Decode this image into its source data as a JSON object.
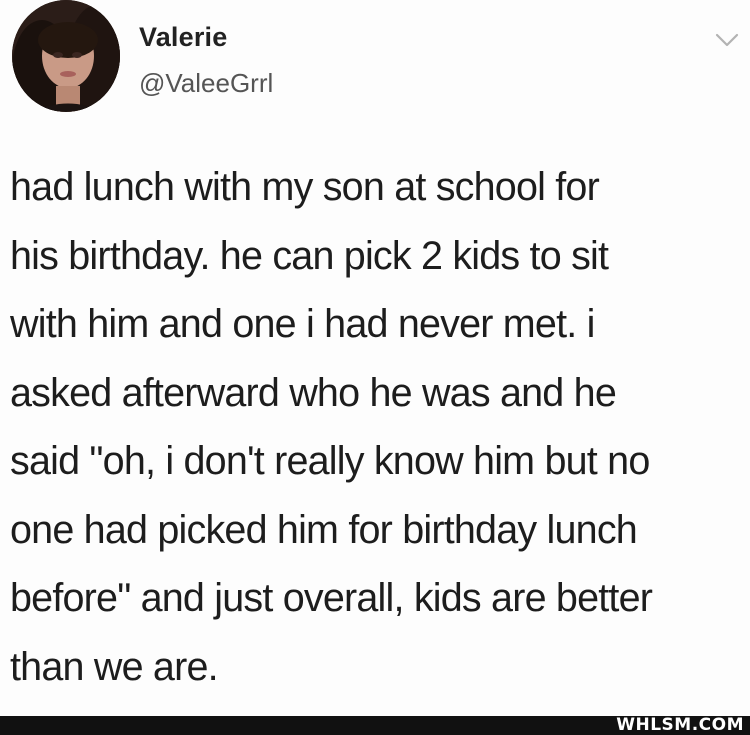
{
  "tweet": {
    "author": {
      "display_name": "Valerie",
      "handle": "@ValeeGrrl",
      "avatar_icon": "profile-photo"
    },
    "menu_icon": "chevron-down-icon",
    "text": "had lunch with my son at school for\nhis birthday. he can pick 2 kids to sit\nwith him and one i had never met. i\nasked afterward who he was and he\nsaid \"oh, i don't really know him but no\none had picked him for birthday lunch\nbefore\" and just overall, kids are better\nthan we are."
  },
  "footer": {
    "watermark": "WHLSM.COM",
    "bar_color": "#111111"
  }
}
